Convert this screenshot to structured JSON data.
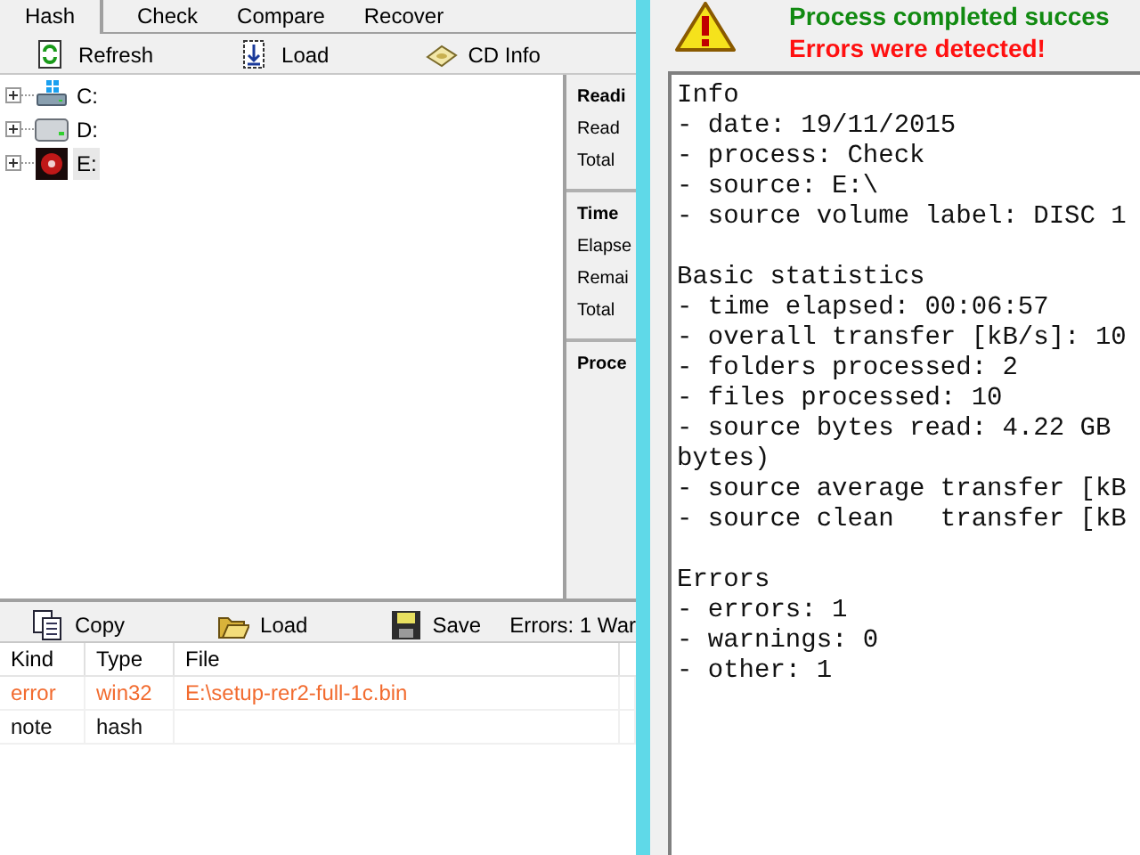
{
  "main_window": {
    "menu": [
      {
        "label": "Hash",
        "selected": true
      },
      {
        "label": "Check",
        "selected": false
      },
      {
        "label": "Compare",
        "selected": false
      },
      {
        "label": "Recover",
        "selected": false
      }
    ],
    "toolbar": [
      {
        "label": "Refresh"
      },
      {
        "label": "Load"
      },
      {
        "label": "CD Info"
      }
    ],
    "drive_tree": [
      {
        "label": "C:",
        "expanded": false,
        "selected": false
      },
      {
        "label": "D:",
        "expanded": false,
        "selected": false
      },
      {
        "label": "E:",
        "expanded": false,
        "selected": true
      }
    ],
    "side_panel": [
      {
        "heading": "Readi",
        "items": [
          "Read",
          "Total"
        ]
      },
      {
        "heading": "Time",
        "items": [
          "Elapse",
          "Remai",
          "Total"
        ]
      },
      {
        "heading": "Proce"
      }
    ],
    "log_toolbar": [
      {
        "label": "Copy"
      },
      {
        "label": "Load"
      },
      {
        "label": "Save"
      }
    ],
    "status": "Errors: 1 War",
    "log_table": {
      "columns": [
        "Kind",
        "Type",
        "File"
      ],
      "rows": [
        {
          "kind": "error",
          "cells": [
            "error",
            "win32",
            "E:\\setup-rer2-full-1c.bin"
          ]
        },
        {
          "kind": "note",
          "cells": [
            "note",
            "hash"
          ]
        }
      ]
    }
  },
  "report_window": {
    "title": "Process completed succes",
    "subtitle": "Errors were detected!",
    "sections": [
      {
        "heading": "Info",
        "lines": [
          "- date: 19/11/2015",
          "- process: Check",
          "- source: E:\\",
          "- source volume label: DISC 1"
        ]
      },
      {
        "heading": "Basic statistics",
        "lines": [
          "- time elapsed: 00:06:57",
          "- overall transfer [kB/s]: 10",
          "- folders processed: 2",
          "- files processed: 10",
          "- source bytes read: 4.22 GB",
          "bytes)",
          "- source average transfer [kB",
          "- source clean   transfer [kB"
        ]
      },
      {
        "heading": "Errors",
        "lines": [
          "- errors: 1",
          "- warnings: 0",
          "- other: 1"
        ]
      }
    ]
  }
}
